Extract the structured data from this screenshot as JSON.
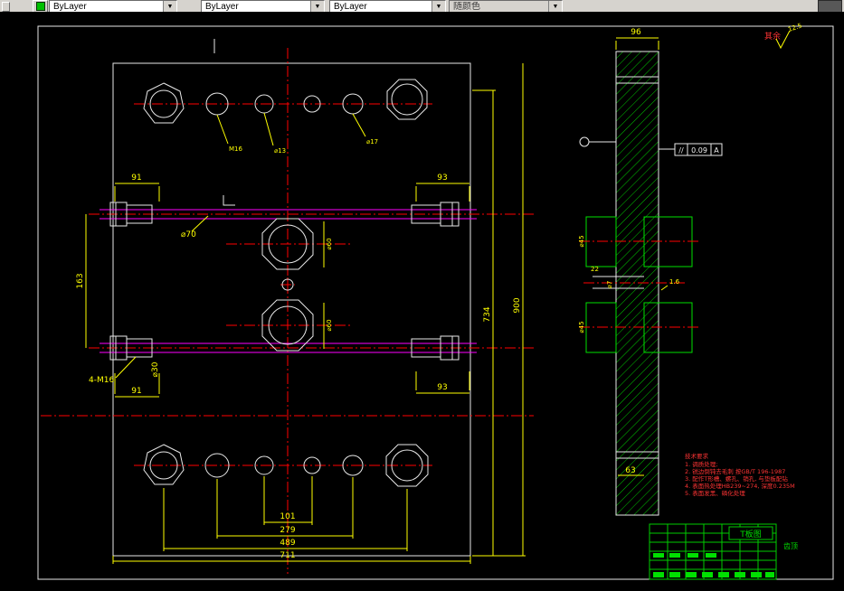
{
  "toolbar": {
    "layer": "ByLayer",
    "linetype": "ByLayer",
    "lineweight": "ByLayer",
    "plotstyle": "随颜色"
  },
  "dims": {
    "top_left": "91",
    "top_right": "93",
    "bottom_left": "91",
    "bottom_right": "93",
    "width_101": "101",
    "width_279": "279",
    "width_489": "489",
    "width_711": "711",
    "height_734": "734",
    "height_900": "900",
    "height_163": "163",
    "rod_dia": "⌀70",
    "rod2_dia": "⌀30",
    "thread": "4-M16",
    "hub_upper": "⌀60",
    "hub_lower": "⌀60",
    "callout_a": "M16",
    "callout_b": "⌀13",
    "callout_c": "⌀17",
    "sec_width": "96",
    "sec_slot": "22",
    "sec_pin": "⌀7",
    "sec_fit": "1.6",
    "sec_bottom": "63",
    "sec_hub_upper": "⌀45",
    "sec_hub_lower": "⌀45"
  },
  "tolerance": {
    "symbol": "//",
    "value": "0.09",
    "datum": "A"
  },
  "roughness": {
    "other": "其余",
    "value": "12.5"
  },
  "notes": {
    "title": "技术要求",
    "item1": "1. 调质处理;",
    "item2": "2. 锐边倒钝去毛刺 按GB/T 196-1987",
    "item3": "3. 配作T形槽、螺孔、销孔, 与垫板配钻",
    "item4": "4. 表面热处理HB239~274, 深度0.235M",
    "item5": "5. 表面发黑、磷化处理"
  },
  "title_block": {
    "name": "T板图",
    "label": "齿顶"
  }
}
